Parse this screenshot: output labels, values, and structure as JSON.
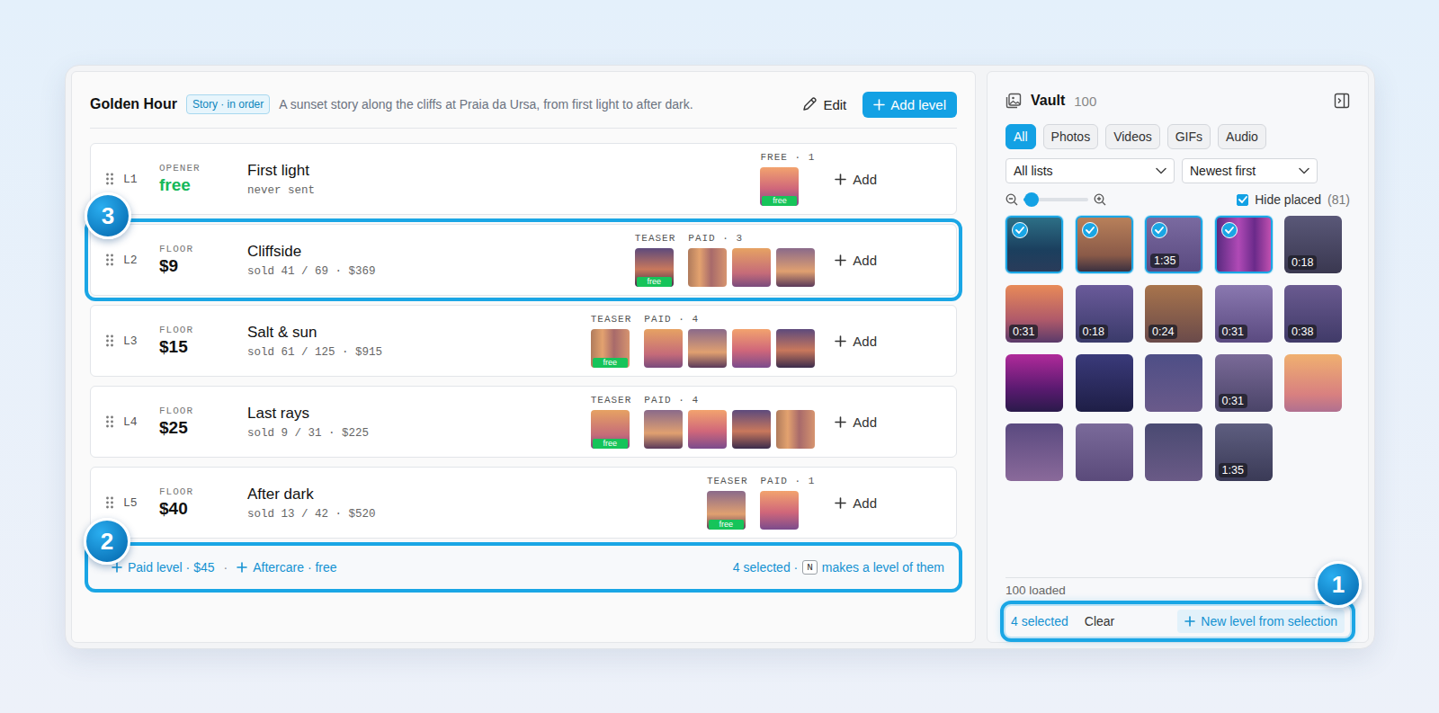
{
  "story": {
    "title": "Golden Hour",
    "badge": "Story · in order",
    "description": "A sunset story along the cliffs at Praia da Ursa, from first light to after dark.",
    "edit": "Edit",
    "add_level": "Add level"
  },
  "levels": [
    {
      "index": "L1",
      "tier": "OPENER",
      "price": "free",
      "color": "#16b85a",
      "name": "First light",
      "stats": "never sent",
      "highlighted": false,
      "add": "Add",
      "groups": [
        {
          "label": "FREE · 1",
          "items": [
            {
              "kind": "teaser",
              "badge": "free"
            }
          ]
        }
      ]
    },
    {
      "index": "L2",
      "tier": "FLOOR",
      "price": "$9",
      "color": "#111111",
      "name": "Cliffside",
      "stats": "sold 41 / 69 · $369",
      "highlighted": true,
      "callout": "3",
      "add": "Add",
      "groups": [
        {
          "label": "TEASER",
          "items": [
            {
              "kind": "teaser",
              "badge": "free"
            }
          ]
        },
        {
          "label": "PAID · 3",
          "items": [
            {
              "kind": "paid"
            },
            {
              "kind": "paid"
            },
            {
              "kind": "paid"
            }
          ]
        }
      ]
    },
    {
      "index": "L3",
      "tier": "FLOOR",
      "price": "$15",
      "color": "#111111",
      "name": "Salt & sun",
      "stats": "sold 61 / 125 · $915",
      "highlighted": false,
      "add": "Add",
      "groups": [
        {
          "label": "TEASER",
          "items": [
            {
              "kind": "teaser",
              "badge": "free"
            }
          ]
        },
        {
          "label": "PAID · 4",
          "items": [
            {
              "kind": "paid"
            },
            {
              "kind": "paid"
            },
            {
              "kind": "paid"
            },
            {
              "kind": "paid"
            }
          ]
        }
      ]
    },
    {
      "index": "L4",
      "tier": "FLOOR",
      "price": "$25",
      "color": "#111111",
      "name": "Last rays",
      "stats": "sold 9 / 31 · $225",
      "highlighted": false,
      "add": "Add",
      "groups": [
        {
          "label": "TEASER",
          "items": [
            {
              "kind": "teaser",
              "badge": "free"
            }
          ]
        },
        {
          "label": "PAID · 4",
          "items": [
            {
              "kind": "paid"
            },
            {
              "kind": "paid"
            },
            {
              "kind": "paid"
            },
            {
              "kind": "paid"
            }
          ]
        }
      ]
    },
    {
      "index": "L5",
      "tier": "FLOOR",
      "price": "$40",
      "color": "#111111",
      "name": "After dark",
      "stats": "sold 13 / 42 · $520",
      "highlighted": false,
      "add": "Add",
      "groups": [
        {
          "label": "TEASER",
          "items": [
            {
              "kind": "teaser",
              "badge": "free"
            }
          ]
        },
        {
          "label": "PAID · 1",
          "items": [
            {
              "kind": "paid"
            }
          ]
        }
      ]
    }
  ],
  "footer": {
    "paid_level": "Paid level · $45",
    "separator": "·",
    "aftercare": "Aftercare · free",
    "selected": "4 selected ·",
    "key": "N",
    "hint": "makes a level of them",
    "highlighted": true,
    "callout": "2"
  },
  "vault": {
    "title": "Vault",
    "count": "100",
    "filters": [
      {
        "label": "All",
        "selected": true
      },
      {
        "label": "Photos",
        "selected": false
      },
      {
        "label": "Videos",
        "selected": false
      },
      {
        "label": "GIFs",
        "selected": false
      },
      {
        "label": "Audio",
        "selected": false
      }
    ],
    "list_select": "All lists",
    "sort_select": "Newest first",
    "zoom": {
      "level": 0.12
    },
    "hide_placed": {
      "label": "Hide placed",
      "checked": true,
      "count": "(81)"
    },
    "items": [
      {
        "selected": true
      },
      {
        "selected": true
      },
      {
        "selected": true,
        "duration": "1:35"
      },
      {
        "selected": true
      },
      {
        "selected": false,
        "duration": "0:18"
      },
      {
        "selected": false,
        "duration": "0:31"
      },
      {
        "selected": false,
        "duration": "0:18"
      },
      {
        "selected": false,
        "duration": "0:24"
      },
      {
        "selected": false,
        "duration": "0:31"
      },
      {
        "selected": false,
        "duration": "0:38"
      },
      {
        "selected": false
      },
      {
        "selected": false
      },
      {
        "selected": false
      },
      {
        "selected": false,
        "duration": "0:31"
      },
      {
        "selected": false
      },
      {
        "selected": false
      },
      {
        "selected": false
      },
      {
        "selected": false
      },
      {
        "selected": false,
        "duration": "1:35"
      }
    ],
    "loaded": "100 loaded",
    "selection": {
      "count": "4 selected",
      "clear": "Clear",
      "action": "New level from selection",
      "highlighted": true,
      "callout": "1"
    }
  }
}
